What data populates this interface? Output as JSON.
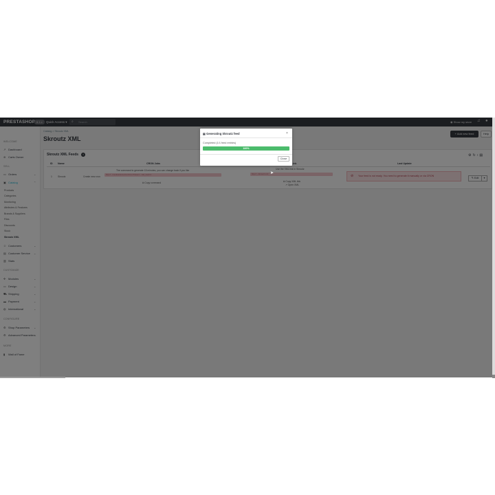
{
  "topbar": {
    "logo": "PRESTASHOP",
    "version": "8.1.x",
    "shop": "Quick Access",
    "search_placeholder": "Search",
    "show_store": "Show my store"
  },
  "sidebar": {
    "sections": {
      "welcome": "WELCOME",
      "sell": "SELL",
      "customize": "CUSTOMIZE",
      "configure": "CONFIGURE",
      "more": "MORE"
    },
    "items": {
      "dashboard": "Dashboard",
      "carts": "Carts Owner",
      "orders": "Orders",
      "catalog": "Catalog",
      "customers": "Customers",
      "customer_service": "Customer Service",
      "stats": "Stats",
      "modules": "Modules",
      "design": "Design",
      "shipping": "Shipping",
      "payment": "Payment",
      "international": "International",
      "shop_parameters": "Shop Parameters",
      "advanced_parameters": "Advanced Parameters",
      "wall_of_fame": "Wall of Fame"
    },
    "catalog_sub": [
      "Products",
      "Categories",
      "Monitoring",
      "Attributes & Features",
      "Brands & Suppliers",
      "Files",
      "Discounts",
      "Stock",
      "Skroutz XML"
    ]
  },
  "page": {
    "breadcrumb": "Catalog  >  Skroutz XML",
    "title": "Skroutz XML",
    "add_button": "+ Add new feed",
    "help_button": "Help"
  },
  "card": {
    "title": "Skroutz XML Feeds",
    "headers": {
      "id": "ID",
      "name": "Name",
      "cron": "CRON Jobs",
      "link": "Link",
      "last_update": "Last Update"
    },
    "row": {
      "id": "1",
      "name": "Skroutz",
      "cron_label": "Create new cron",
      "cron_note": "The command to generate 15 minutes, you can change back if you like",
      "cron_url": "http://.../module/skroutzxml/cron?token=...&id_feed=1",
      "copy_command": "Copy command",
      "link_note": "Use the XML link in Skroutz",
      "link_url": "http://.../skroutz.xml",
      "copy_xml": "Copy XML link",
      "open_xml": "Open XML",
      "alert": "Your feed is not ready. You need to generate it manually or via CRON",
      "edit": "Edit"
    }
  },
  "modal": {
    "title": "Generating Skroutz feed",
    "status": "Completed (1/1 feed entries)",
    "progress_label": "100%",
    "progress_value": 100,
    "close": "Close"
  }
}
